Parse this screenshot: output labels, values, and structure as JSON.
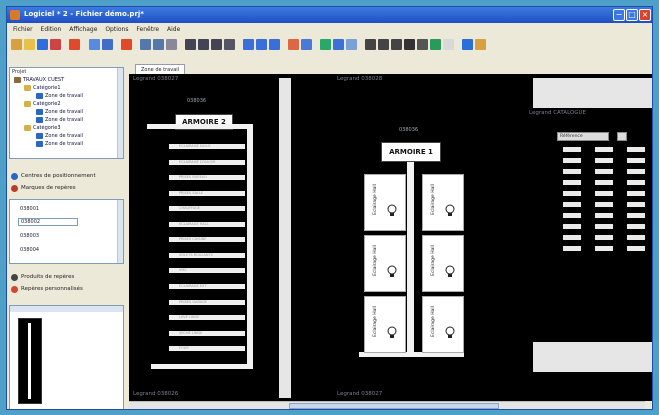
{
  "window": {
    "title": "Logiciel * 2 - Fichier démo.prj*"
  },
  "menu": [
    "Fichier",
    "Edition",
    "Affichage",
    "Options",
    "Fenêtre",
    "Aide"
  ],
  "tab_label": "Zone de travail",
  "sidebar": {
    "header": "Projet",
    "tree": [
      {
        "label": "TRAVAUX CUEST",
        "level": 0
      },
      {
        "label": "Catégorie1",
        "level": 1
      },
      {
        "label": "Zone de travail",
        "level": 2
      },
      {
        "label": "Catégorie2",
        "level": 1
      },
      {
        "label": "Zone de travail",
        "level": 2
      },
      {
        "label": "Zone de travail",
        "level": 2
      },
      {
        "label": "Catégorie3",
        "level": 1
      },
      {
        "label": "Zone de travail",
        "level": 2
      },
      {
        "label": "Zone de travail",
        "level": 2
      }
    ],
    "links_top": [
      {
        "label": "Centres de positionnement",
        "color": "#2a66c8"
      },
      {
        "label": "Marques de repères",
        "color": "#c0392b"
      }
    ],
    "list_items": [
      "038001",
      "038002",
      "038003",
      "038004"
    ],
    "links_bottom": [
      {
        "label": "Produits de repères",
        "color": "#444444"
      },
      {
        "label": "Repères personnalisés",
        "color": "#d8442a"
      }
    ]
  },
  "canvas": {
    "panel_labels": [
      "Legrand 038027",
      "Legrand 038028",
      "Legrand CATALOGUE",
      "Legrand 038026",
      "Legrand 038027"
    ],
    "cabinet_2": {
      "code": "038036",
      "title": "ARMOIRE 2"
    },
    "cabinet_1": {
      "code": "038036",
      "title": "ARMOIRE 1"
    },
    "module_label": "Eclairage Hall",
    "din_labels": [
      "ECLAIRAGE SALLE",
      "ECLAIRAGE COULOIR",
      "PRISES BUREAU",
      "PRISES SALLE",
      "CHAUFFAGE",
      "ECLAIRAGE HALL",
      "PRISES CUISINE",
      "VOLETS ROULANTS",
      "VMC",
      "ECLAIRAGE EXT",
      "PRISES GARAGE",
      "LAVE LINGE",
      "SECHE LINGE",
      "FOUR"
    ],
    "catalog_header": "Référence"
  },
  "icons": [
    "new-icon",
    "open-icon",
    "save-icon",
    "close-doc-icon",
    "copy-icon",
    "paste-icon",
    "delete-icon",
    "undo-icon",
    "redo-icon",
    "link-icon",
    "align-icon",
    "zoom-in-icon",
    "zoom-out-icon",
    "zoom-fit-icon",
    "graph-icon",
    "grid-icon",
    "print-icon",
    "label-icon",
    "help-icon"
  ],
  "colors": {
    "accent": "#1f4fc4",
    "canvas": "#000000",
    "toolbar_blue": "#2f6fdc"
  }
}
